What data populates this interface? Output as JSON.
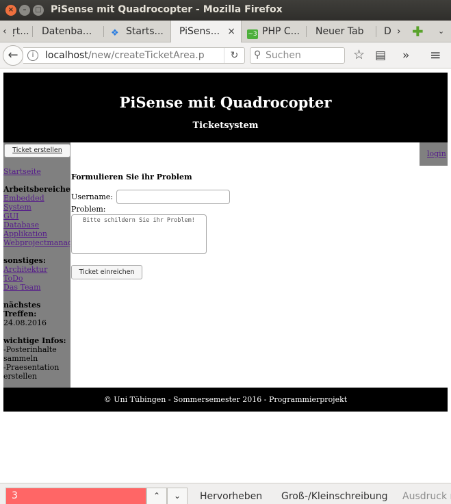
{
  "window": {
    "title": "PiSense mit Quadrocopter - Mozilla Firefox",
    "close_glyph": "×",
    "min_glyph": "–",
    "max_glyph": "□"
  },
  "tabs": [
    {
      "label": "ŗt...",
      "icon": "none"
    },
    {
      "label": "Datenba...",
      "icon": "none"
    },
    {
      "label": "Starts...",
      "icon": "dropbox-icon"
    },
    {
      "label": "PiSens...",
      "icon": "none",
      "active": true
    },
    {
      "label": "PHP C...",
      "icon": "php-icon"
    },
    {
      "label": "Neuer Tab",
      "icon": "none"
    },
    {
      "label": "D",
      "icon": "none"
    }
  ],
  "tab_close_glyph": "×",
  "navbar": {
    "url_host": "localhost",
    "url_path": "/new/createTicketArea.p",
    "search_placeholder": "Suchen",
    "back_glyph": "←",
    "reload_glyph": "↻",
    "info_glyph": "i",
    "search_glyph": "⚲",
    "star_glyph": "☆",
    "library_glyph": "▤",
    "overflow_glyph": "»",
    "menu_glyph": "≡"
  },
  "site": {
    "title": "PiSense mit Quadrocopter",
    "subtitle": "Ticketsystem",
    "footer": "© Uni Tübingen - Sommersemester 2016 - Programmierprojekt",
    "login": "login"
  },
  "sidebar": {
    "ticket_button": "Ticket erstellen",
    "startseite": "Startseite",
    "arbeitsbereiche_heading": "Arbeitsbereiche",
    "arbeitsbereiche_links": [
      "Embedded",
      "System",
      "GUI",
      "Database",
      "Applikation",
      "Webprojectmanagement"
    ],
    "sonstiges_heading": "sonstiges:",
    "sonstiges_links": [
      "Architektur",
      "ToDo",
      "Das Team"
    ],
    "treffen_heading_1": "nächstes",
    "treffen_heading_2": "Treffen:",
    "treffen_date": "24.08.2016",
    "infos_heading": "wichtige Infos:",
    "infos_lines": [
      "-Posterinhalte",
      "sammeln",
      "-Praesentation",
      "erstellen"
    ]
  },
  "form": {
    "title": "Formulieren Sie ihr Problem",
    "username_label": "Username:",
    "username_value": "",
    "problem_label": "Problem:",
    "problem_placeholder": "Bitte schildern Sie ihr Problem!",
    "submit_label": "Ticket einreichen"
  },
  "findbar": {
    "query": "3",
    "up_glyph": "⌃",
    "down_glyph": "⌄",
    "highlight": "Hervorheben",
    "case_sensitive": "Groß-/Kleinschreibung",
    "whole_words": "Ausdruck m"
  }
}
